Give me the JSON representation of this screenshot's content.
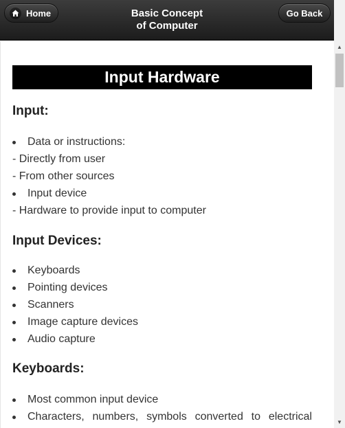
{
  "header": {
    "title_line1": "Basic Concept",
    "title_line2": "of Computer",
    "home_label": "Home",
    "back_label": "Go Back"
  },
  "content": {
    "banner": "Input Hardware",
    "sections": [
      {
        "heading": "Input:",
        "lines": [
          {
            "type": "bullet",
            "text": "Data or instructions:"
          },
          {
            "type": "plain",
            "text": "- Directly from user"
          },
          {
            "type": "plain",
            "text": "- From other sources"
          },
          {
            "type": "bullet",
            "text": "Input device"
          },
          {
            "type": "plain",
            "text": "- Hardware to provide input to computer"
          }
        ]
      },
      {
        "heading": "Input Devices:",
        "lines": [
          {
            "type": "bullet",
            "text": "Keyboards"
          },
          {
            "type": "bullet",
            "text": "Pointing devices"
          },
          {
            "type": "bullet",
            "text": "Scanners"
          },
          {
            "type": "bullet",
            "text": "Image capture devices"
          },
          {
            "type": "bullet",
            "text": "Audio capture"
          }
        ]
      },
      {
        "heading": "Keyboards:",
        "lines": [
          {
            "type": "bullet",
            "text": "Most common input device"
          },
          {
            "type": "bullet",
            "words": [
              "Characters,",
              "numbers,",
              "symbols",
              "converted",
              "to",
              "electrical"
            ]
          }
        ]
      }
    ]
  },
  "icons": {
    "home": "home-icon",
    "scroll_up": "arrow-up-icon",
    "scroll_down": "arrow-down-icon"
  }
}
